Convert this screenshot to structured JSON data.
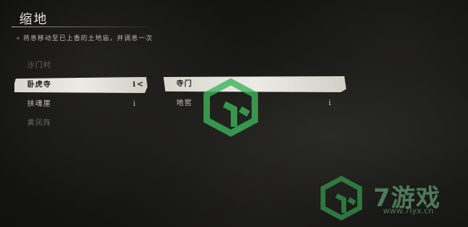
{
  "header": {
    "title": "缩地",
    "hint": "将息移动至已上香的土地庙，并调息一次"
  },
  "regions": [
    {
      "label": "沙门村",
      "state": "dim",
      "marker": ""
    },
    {
      "label": "卧虎寺",
      "state": "selected",
      "marker": "i",
      "chevron": "<"
    },
    {
      "label": "扶魂崖",
      "state": "normal",
      "marker": "i"
    },
    {
      "label": "黄风阵",
      "state": "dim",
      "marker": ""
    }
  ],
  "shrines": [
    {
      "label": "寺门",
      "state": "selected",
      "marker": ""
    },
    {
      "label": "地窖",
      "state": "normal",
      "marker": "i"
    }
  ],
  "watermark": {
    "brand": "7游戏",
    "url": "www.7lyx.cn",
    "color": "#3cb45a"
  }
}
